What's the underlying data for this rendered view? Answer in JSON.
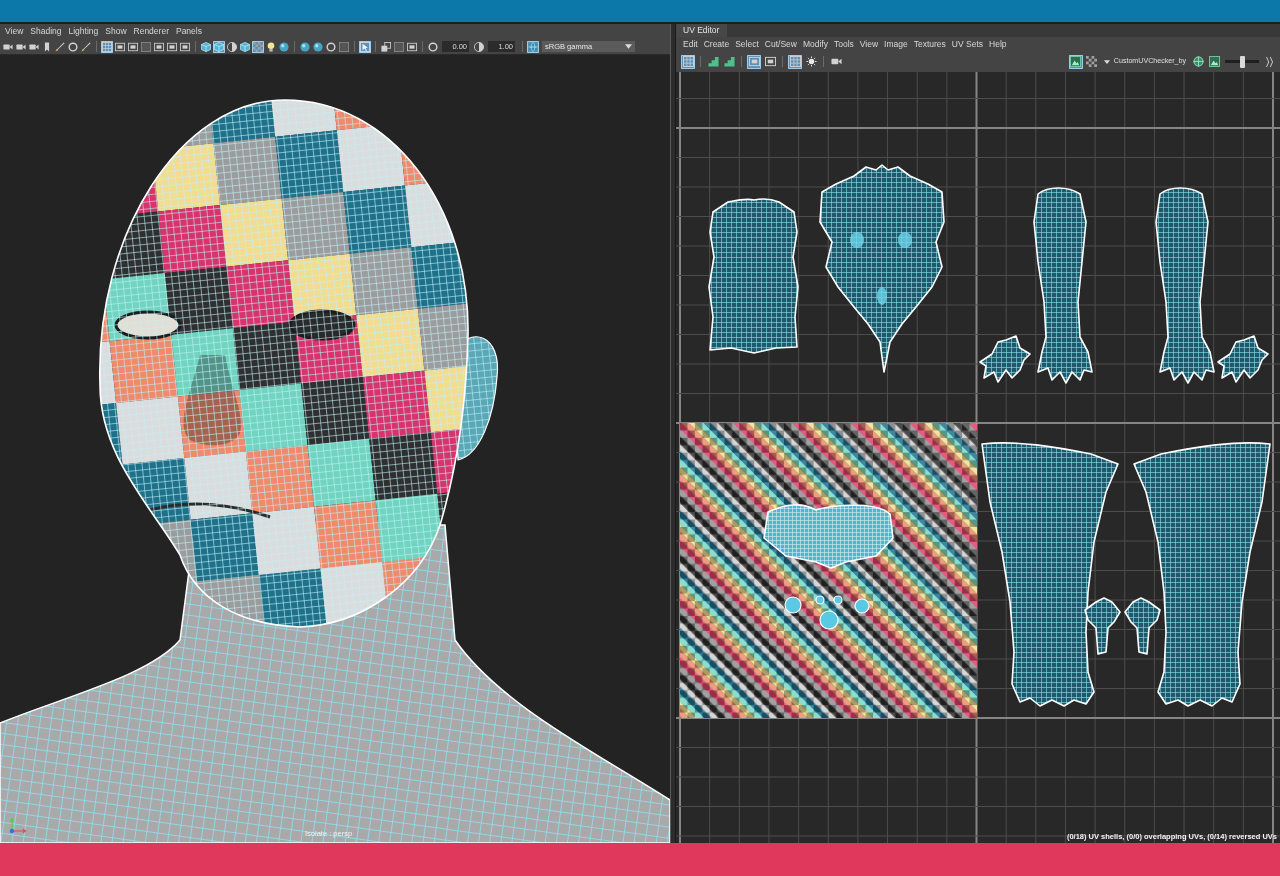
{
  "viewport": {
    "menu": [
      "View",
      "Shading",
      "Lighting",
      "Show",
      "Renderer",
      "Panels"
    ],
    "toolbar": {
      "buttons": [
        {
          "on": false
        },
        {
          "on": false
        },
        {
          "on": false
        },
        {
          "on": false
        },
        {
          "on": false
        },
        {
          "on": false
        },
        {
          "on": false
        },
        {
          "on": true
        },
        {
          "on": false
        },
        {
          "on": false
        },
        {
          "on": false
        },
        {
          "on": false
        },
        {
          "on": false
        },
        {
          "on": false
        },
        {
          "on": false
        },
        {
          "on": true
        },
        {
          "on": false
        },
        {
          "on": false
        },
        {
          "on": true
        },
        {
          "on": false
        },
        {
          "on": false
        },
        {
          "on": false
        },
        {
          "on": false
        },
        {
          "on": false
        },
        {
          "on": false
        },
        {
          "on": true
        },
        {
          "on": false
        },
        {
          "on": false
        },
        {
          "on": false
        },
        {
          "on": false
        },
        {
          "on": false
        },
        {
          "on": true
        }
      ],
      "fields": [
        "0.00",
        "1.00"
      ],
      "color_space": "sRGB gamma"
    },
    "camera_label": "Isolate : persp"
  },
  "uv_editor": {
    "title": "UV Editor",
    "menu": [
      "Edit",
      "Create",
      "Select",
      "Cut/Sew",
      "Modify",
      "Tools",
      "View",
      "Image",
      "Textures",
      "UV Sets",
      "Help"
    ],
    "toolbar": {
      "buttons": [
        {
          "on": true
        },
        {
          "on": false
        },
        {
          "on": false
        },
        {
          "on": true
        },
        {
          "on": false
        },
        {
          "on": true
        },
        {
          "on": false
        },
        {
          "on": false
        },
        {
          "on": true
        },
        {
          "on": false
        },
        {
          "on": false
        },
        {
          "on": false
        }
      ],
      "texture": "CustomUVChecker_by",
      "slider": {
        "level": 0.5
      }
    },
    "status": "(0/18) UV shells, (0/0) overlapping UVs, (0/14) reversed UVs"
  }
}
